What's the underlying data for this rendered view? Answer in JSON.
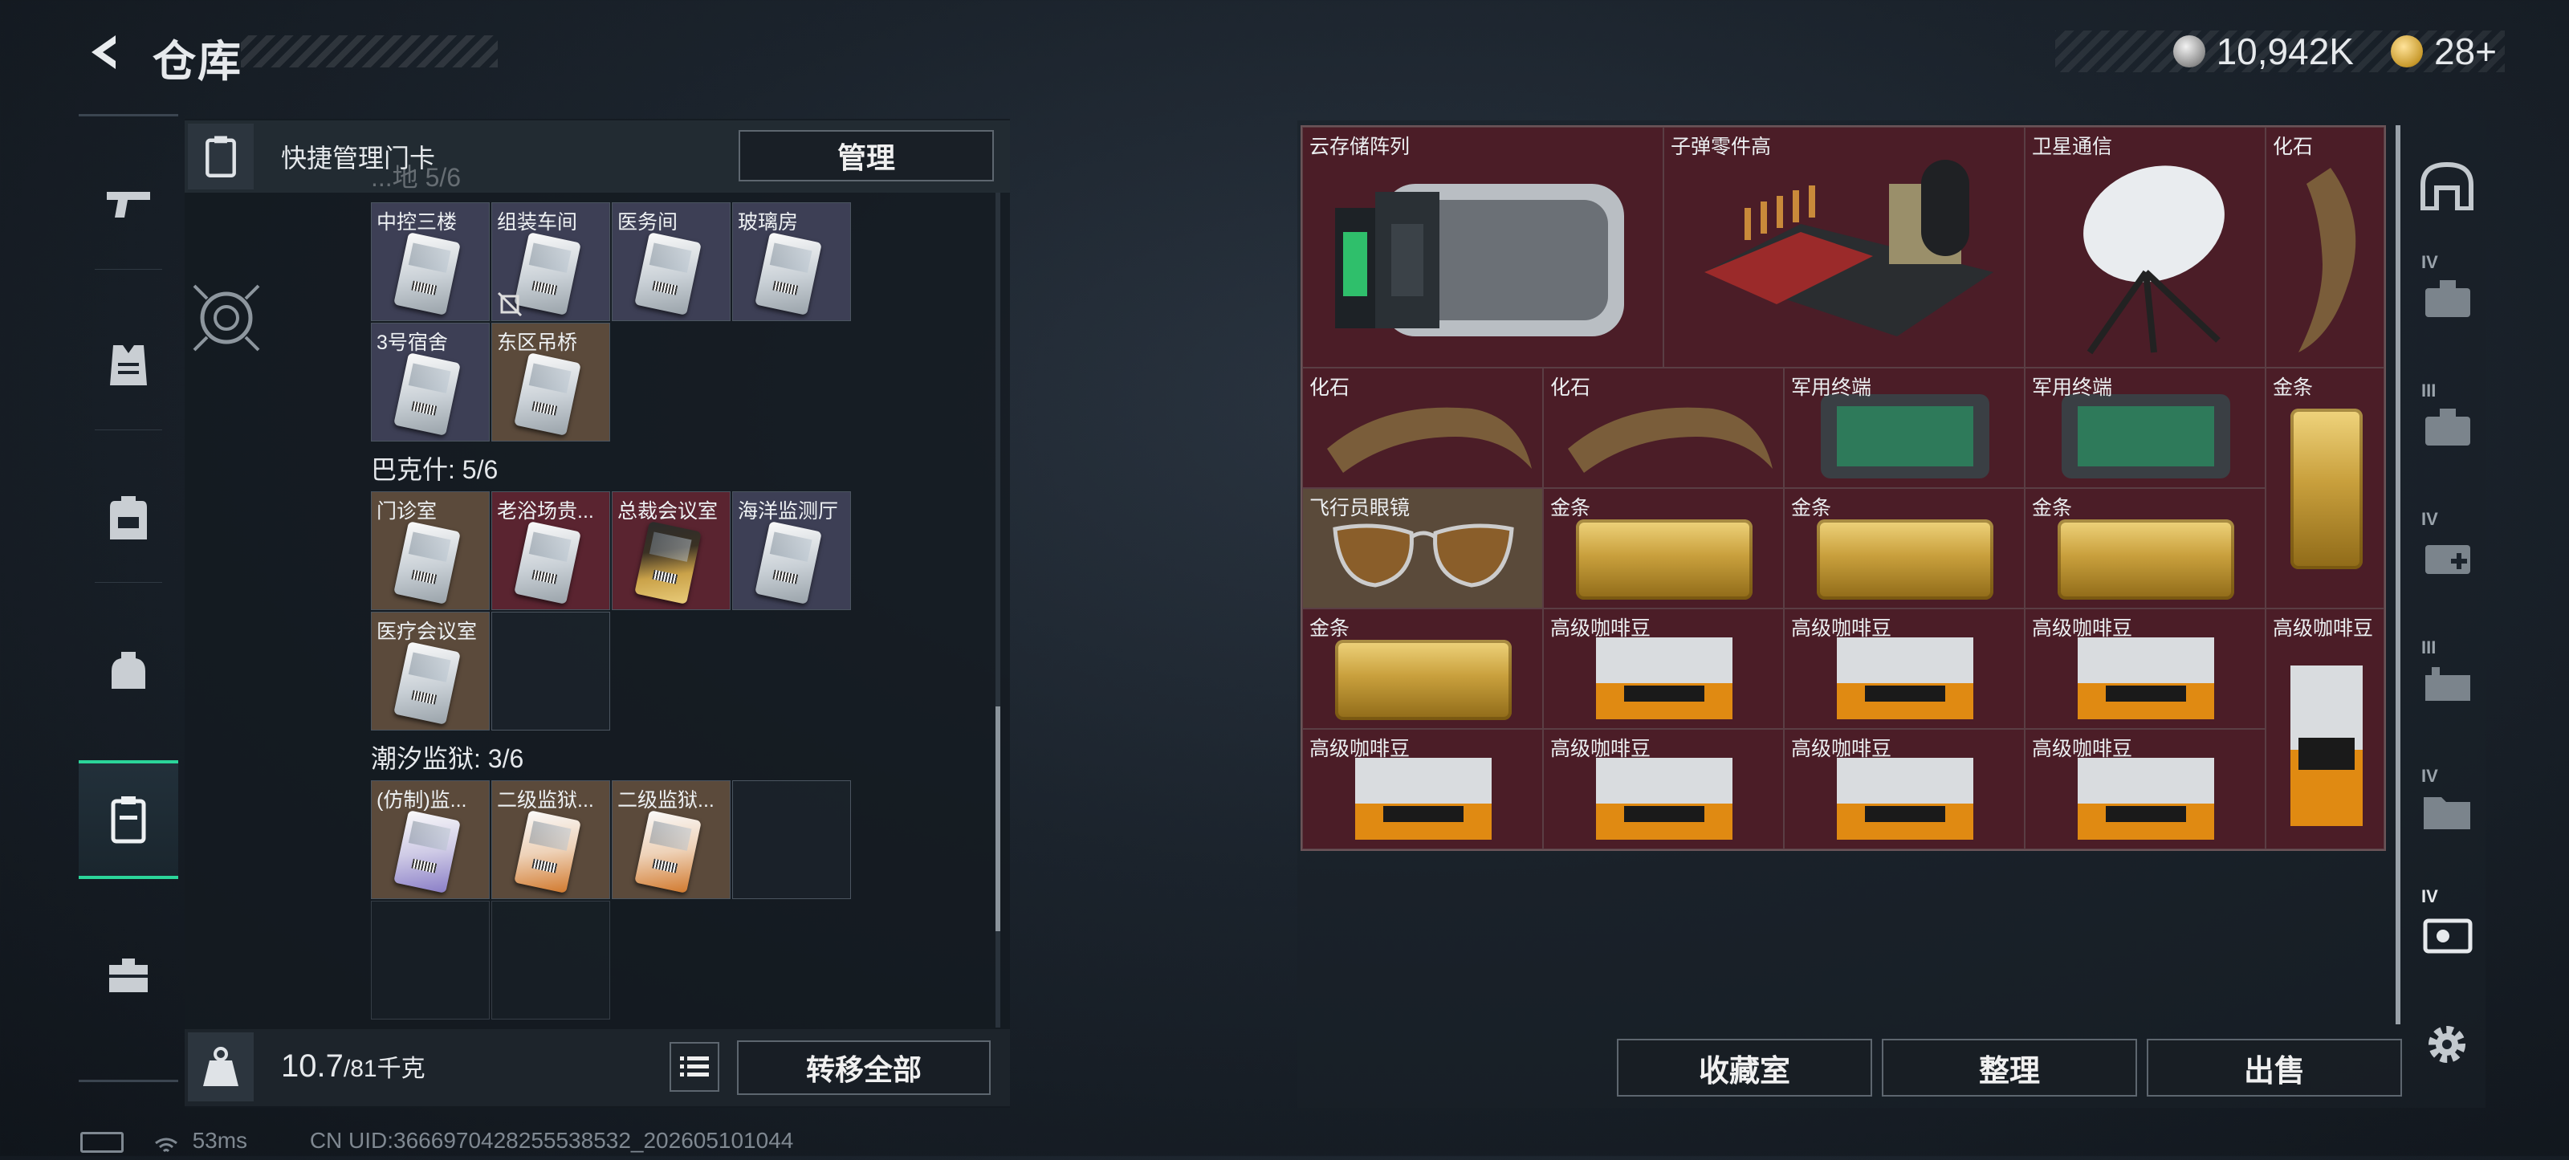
{
  "header": {
    "title": "仓库"
  },
  "currency": {
    "silver": "10,942K",
    "gold": "28+"
  },
  "quick_manage": {
    "label": "快捷管理门卡",
    "manage_button": "管理"
  },
  "sections": [
    {
      "title": "...地 5/6",
      "cells": [
        "中控三楼",
        "组装车间",
        "医务间",
        "玻璃房",
        "3号宿舍",
        "东区吊桥"
      ]
    },
    {
      "title": "巴克什: 5/6",
      "cells": [
        "门诊室",
        "老浴场贵...",
        "总裁会议室",
        "海洋监测厅",
        "医疗会议室"
      ]
    },
    {
      "title": "潮汐监狱: 3/6",
      "cells": [
        "(仿制)监...",
        "二级监狱...",
        "二级监狱..."
      ]
    }
  ],
  "footer": {
    "weight": "10.7",
    "weight_max": "/81千克",
    "transfer_all": "转移全部"
  },
  "storage": {
    "items": [
      "云存储阵列",
      "子弹零件高",
      "卫星通信",
      "化石",
      "化石",
      "化石",
      "军用终端",
      "军用终端",
      "金条",
      "飞行员眼镜",
      "金条",
      "金条",
      "金条",
      "金条",
      "高级咖啡豆",
      "高级咖啡豆",
      "高级咖啡豆",
      "高级咖啡豆",
      "高级咖啡豆",
      "高级咖啡豆",
      "高级咖啡豆",
      "高级咖啡豆"
    ]
  },
  "right_tabs": [
    "IV",
    "III",
    "IV",
    "III",
    "IV",
    "IV"
  ],
  "buttons": {
    "collection": "收藏室",
    "sort": "整理",
    "sell": "出售"
  },
  "status": {
    "ping": "53ms",
    "uid": "CN UID:3666970428255538532_202605101044"
  },
  "colors": {
    "accent": "#2bd59a",
    "item_red": "#4b1d27"
  }
}
